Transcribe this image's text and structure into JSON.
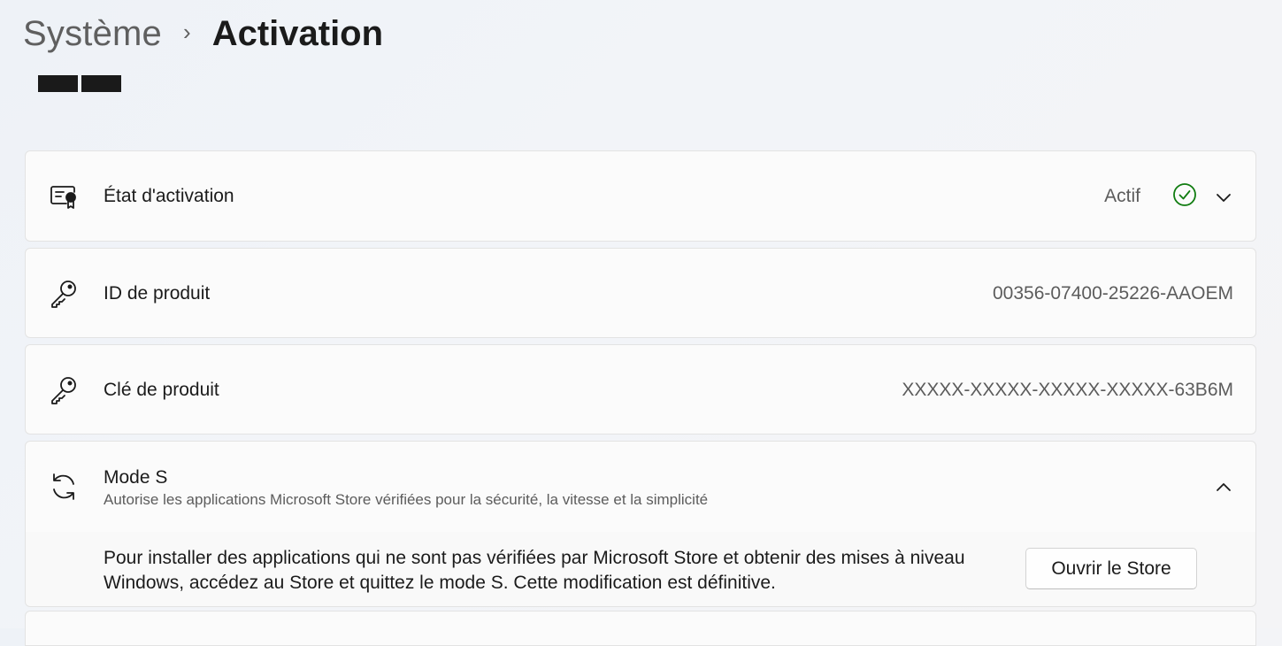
{
  "breadcrumb": {
    "parent": "Système",
    "separator": "›",
    "current": "Activation"
  },
  "activation_state": {
    "icon": "certificate-icon",
    "title": "État d'activation",
    "value": "Actif",
    "status_icon": "check-circle-icon",
    "status_color": "#107c10"
  },
  "product_id": {
    "icon": "key-icon",
    "title": "ID de produit",
    "value": "00356-07400-25226-AAOEM"
  },
  "product_key": {
    "icon": "key-icon",
    "title": "Clé de produit",
    "value": "XXXXX-XXXXX-XXXXX-XXXXX-63B6M"
  },
  "s_mode": {
    "icon": "sync-icon",
    "title": "Mode S",
    "subtitle": "Autorise les applications Microsoft Store vérifiées pour la sécurité, la vitesse et la simplicité",
    "description_line1": "Pour installer des applications qui ne sont pas vérifiées par Microsoft Store et obtenir des mises à niveau",
    "description_line2": "Windows, accédez au Store et quittez le mode S. Cette modification est définitive.",
    "button_label": "Ouvrir le Store"
  }
}
